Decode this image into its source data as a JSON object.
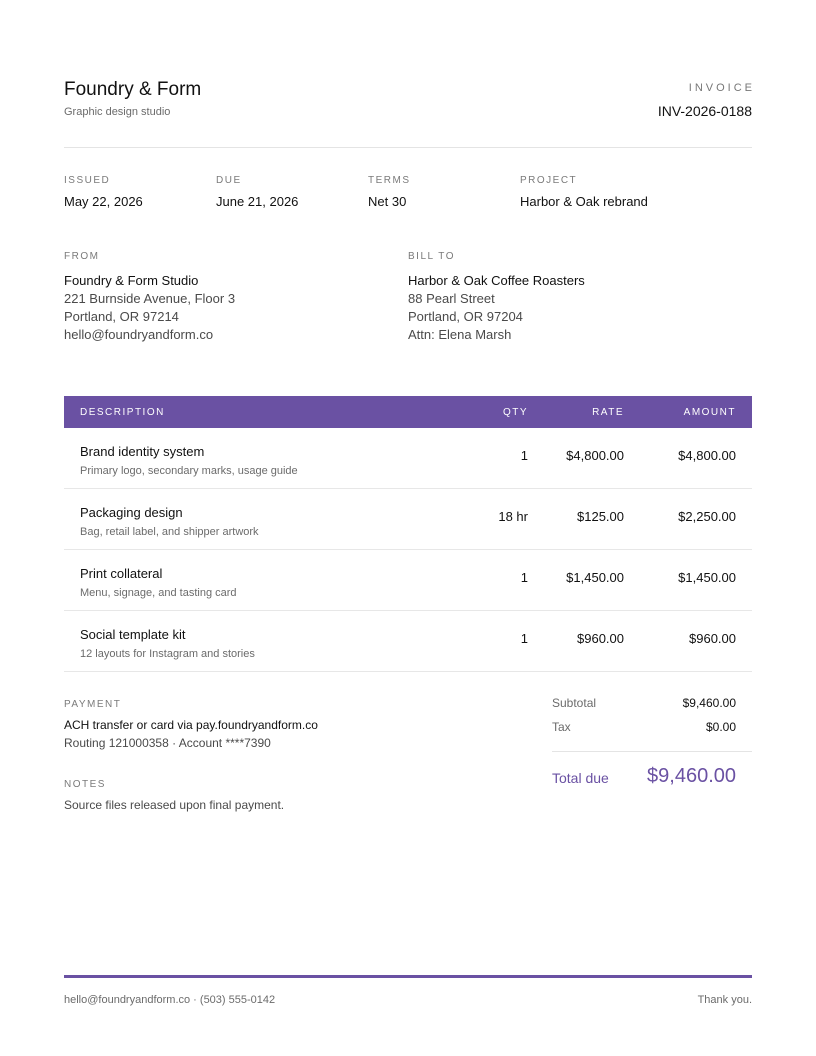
{
  "header": {
    "company_name": "Foundry & Form",
    "tagline": "Graphic design studio",
    "doc_type": "INVOICE",
    "invoice_number": "INV-2026-0188"
  },
  "meta": [
    {
      "label": "ISSUED",
      "value": "May 22, 2026"
    },
    {
      "label": "DUE",
      "value": "June 21, 2026"
    },
    {
      "label": "TERMS",
      "value": "Net 30"
    },
    {
      "label": "PROJECT",
      "value": "Harbor & Oak rebrand"
    }
  ],
  "from": {
    "label": "FROM",
    "lines": [
      "Foundry & Form Studio",
      "221 Burnside Avenue, Floor 3",
      "Portland, OR 97214",
      "hello@foundryandform.co"
    ]
  },
  "bill_to": {
    "label": "BILL TO",
    "lines": [
      "Harbor & Oak Coffee Roasters",
      "88 Pearl Street",
      "Portland, OR 97204",
      "Attn: Elena Marsh"
    ]
  },
  "table": {
    "headers": {
      "description": "DESCRIPTION",
      "qty": "QTY",
      "rate": "RATE",
      "amount": "AMOUNT"
    },
    "rows": [
      {
        "title": "Brand identity system",
        "subtitle": "Primary logo, secondary marks, usage guide",
        "qty": "1",
        "rate": "$4,800.00",
        "amount": "$4,800.00"
      },
      {
        "title": "Packaging design",
        "subtitle": "Bag, retail label, and shipper artwork",
        "qty": "18 hr",
        "rate": "$125.00",
        "amount": "$2,250.00"
      },
      {
        "title": "Print collateral",
        "subtitle": "Menu, signage, and tasting card",
        "qty": "1",
        "rate": "$1,450.00",
        "amount": "$1,450.00"
      },
      {
        "title": "Social template kit",
        "subtitle": "12 layouts for Instagram and stories",
        "qty": "1",
        "rate": "$960.00",
        "amount": "$960.00"
      }
    ]
  },
  "payment": {
    "label": "PAYMENT",
    "lines": [
      "ACH transfer or card via pay.foundryandform.co",
      "Routing 121000358 · Account ****7390"
    ]
  },
  "notes": {
    "label": "NOTES",
    "text": "Source files released upon final payment."
  },
  "totals": {
    "subtotal_label": "Subtotal",
    "subtotal_value": "$9,460.00",
    "tax_label": "Tax",
    "tax_value": "$0.00",
    "total_label": "Total due",
    "total_value": "$9,460.00"
  },
  "footer": {
    "contact": "hello@foundryandform.co · (503) 555-0142",
    "thanks": "Thank you."
  },
  "colors": {
    "accent": "#6a51a3",
    "rule": "#e4e4e4",
    "muted_text": "#6b6b6b"
  }
}
